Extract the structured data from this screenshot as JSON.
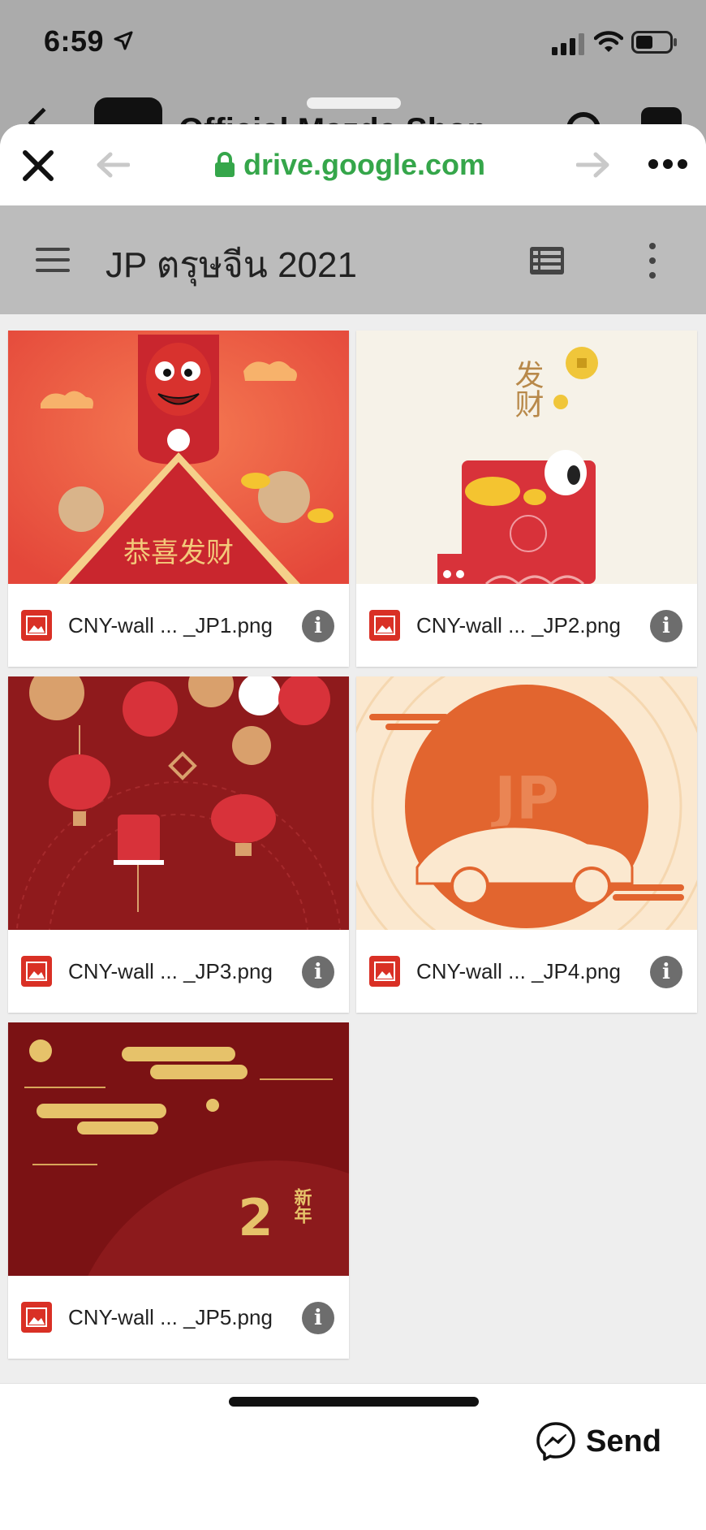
{
  "status": {
    "time": "6:59",
    "icons": [
      "location-arrow-icon",
      "signal-icon",
      "wifi-icon",
      "battery-icon"
    ]
  },
  "background_app": {
    "title": "Official Mazda Shop"
  },
  "browser": {
    "url": "drive.google.com",
    "url_color": "#35a64a",
    "icons": [
      "close-icon",
      "back-arrow-icon",
      "lock-icon",
      "forward-arrow-icon",
      "more-icon"
    ]
  },
  "drive": {
    "folder_title": "JP ตรุษจีน 2021",
    "icons": [
      "menu-icon",
      "list-view-icon",
      "kebab-menu-icon"
    ]
  },
  "files": [
    {
      "name": "CNY-wall ... _JP1.png",
      "thumb_text": "恭喜发财"
    },
    {
      "name": "CNY-wall ... _JP2.png",
      "thumb_text": "发财"
    },
    {
      "name": "CNY-wall ... _JP3.png"
    },
    {
      "name": "CNY-wall ... _JP4.png",
      "thumb_text": "JP"
    },
    {
      "name": "CNY-wall ... _JP5.png",
      "thumb_text": "2",
      "thumb_text_2": "新年"
    }
  ],
  "footer": {
    "send_label": "Send",
    "send_icon": "messenger-icon"
  }
}
